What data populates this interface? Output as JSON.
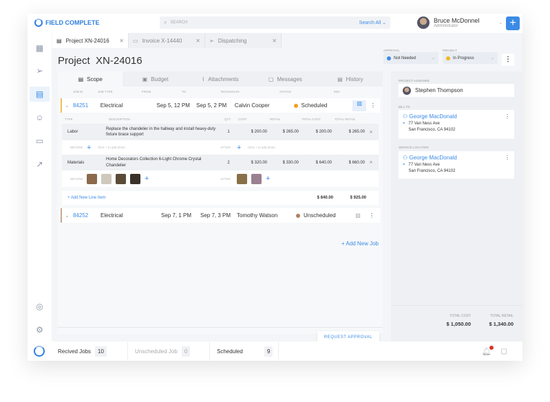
{
  "app": {
    "logo": "FIELD COMPLETE",
    "search_placeholder": "SEARCH",
    "search_scope": "Search All",
    "user_name": "Bruce McDonnel",
    "user_role": "Administrator"
  },
  "tabs": [
    {
      "label": "Project XN-24016"
    },
    {
      "label": "Invoice X-14440"
    },
    {
      "label": "Dispatching"
    }
  ],
  "page": {
    "title": "Project  XN-24016",
    "approval_label": "APPROVAL",
    "approval_value": "Not Needed",
    "project_label": "PROJECT",
    "project_value": "In Progress"
  },
  "main_tabs": [
    "Scope",
    "Budget",
    "Attachments",
    "Messages",
    "History"
  ],
  "job_columns": [
    "JOB ID",
    "JOB TYPE",
    "FROM",
    "TO",
    "TECHNICIAN",
    "STATUS",
    "IMG"
  ],
  "jobs": [
    {
      "id": "84251",
      "type": "Electrical",
      "from": "Sep 5, 12 PM",
      "to": "Sep 5, 2 PM",
      "tech": "Calvin Cooper",
      "status": "Scheduled",
      "status_color": "#f0a020"
    },
    {
      "id": "84252",
      "type": "Electrical",
      "from": "Sep 7, 1 PM",
      "to": "Sep 7, 3 PM",
      "tech": "Tomothy Watson",
      "status": "Unscheduled",
      "status_color": "#b08060"
    }
  ],
  "line_columns": [
    "TYPE",
    "DESCRIPTION",
    "QTY",
    "COST",
    "RETAIL",
    "TOTAL COST",
    "TOTAL RETAIL"
  ],
  "line_items": [
    {
      "type": "Labor",
      "desc": "Replace the chandelier in the hallway and install heavy-duty fixture brace support",
      "qty": "1",
      "cost": "$ 200.00",
      "retail": "$ 265.00",
      "total_cost": "$ 200.00",
      "total_retail": "$ 265.00"
    },
    {
      "type": "Materials",
      "desc": "Home Decorators Collection 6-Light Chrome Crystal Chandelier",
      "qty": "2",
      "cost": "$ 320.00",
      "retail": "$ 330.00",
      "total_cost": "$ 640.00",
      "total_retail": "$ 660.00"
    }
  ],
  "photo_labels": {
    "before": "BEFORE",
    "after": "AFTER",
    "hint": "Click + to add photo"
  },
  "add_line_item": "+ Add New Line Item",
  "subtotal_cost": "$ 840.00",
  "subtotal_retail": "$ 925.00",
  "add_job": "+ Add New Job",
  "request_approval": "REQUEST APPROVAL",
  "right": {
    "assignee_label": "PROJECT ASSIGNEE",
    "assignee": "Stephen Thompson",
    "bill_label": "BILL TO",
    "bill_name": "George MacDonald",
    "bill_addr1": "77 Van Ness Ave",
    "bill_addr2": "San Francisco, CA 94102",
    "svc_label": "SERVICE LOCATION",
    "svc_name": "George MacDonald",
    "svc_addr1": "77 Van Ness Ave",
    "svc_addr2": "San Francisco, CA 94102",
    "total_cost_label": "TOTAL COST",
    "total_cost": "$ 1,050.00",
    "total_retail_label": "TOTAL RETAIL",
    "total_retail": "$ 1,340.00"
  },
  "footer": {
    "received_label": "Recived Jobs",
    "received": "10",
    "unscheduled_label": "Unscheduled Job",
    "unscheduled": "0",
    "scheduled_label": "Scheduled",
    "scheduled": "9"
  }
}
